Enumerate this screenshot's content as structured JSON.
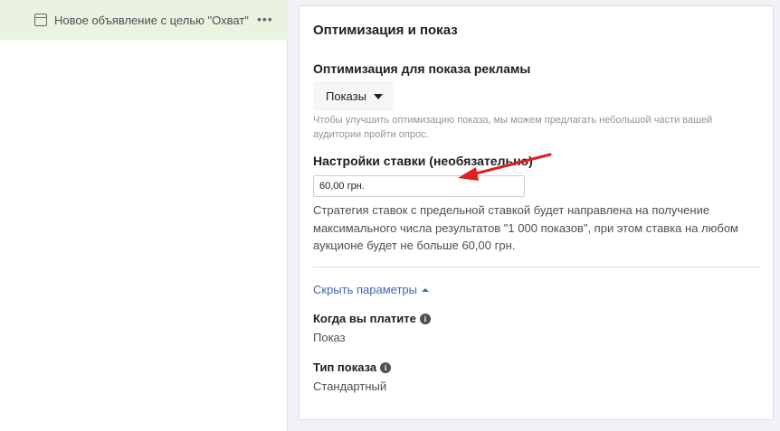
{
  "sidebar": {
    "ad_item": {
      "label": "Новое объявление с целью \"Охват\"",
      "icon": "ad-window-icon",
      "more_icon": "more-options-icon"
    }
  },
  "panel": {
    "title": "Оптимизация и показ",
    "optimization": {
      "label": "Оптимизация для показа рекламы",
      "selected": "Показы",
      "help": "Чтобы улучшить оптимизацию показа, мы можем предлагать небольшой части вашей аудитории пройти опрос."
    },
    "bid": {
      "label": "Настройки ставки (необязательно)",
      "value": "60,00 грн.",
      "description": "Стратегия ставок с предельной ставкой будет направлена на получение максимального числа результатов \"1 000 показов\", при этом ставка на любом аукционе будет не больше 60,00 грн."
    },
    "hide_params_link": "Скрыть параметры",
    "when_you_pay": {
      "label": "Когда вы платите",
      "value": "Показ"
    },
    "delivery_type": {
      "label": "Тип показа",
      "value": "Стандартный"
    }
  },
  "colors": {
    "accent_link": "#4267b2",
    "annotation_arrow": "#e02020",
    "selected_row": "#eaf3df"
  }
}
